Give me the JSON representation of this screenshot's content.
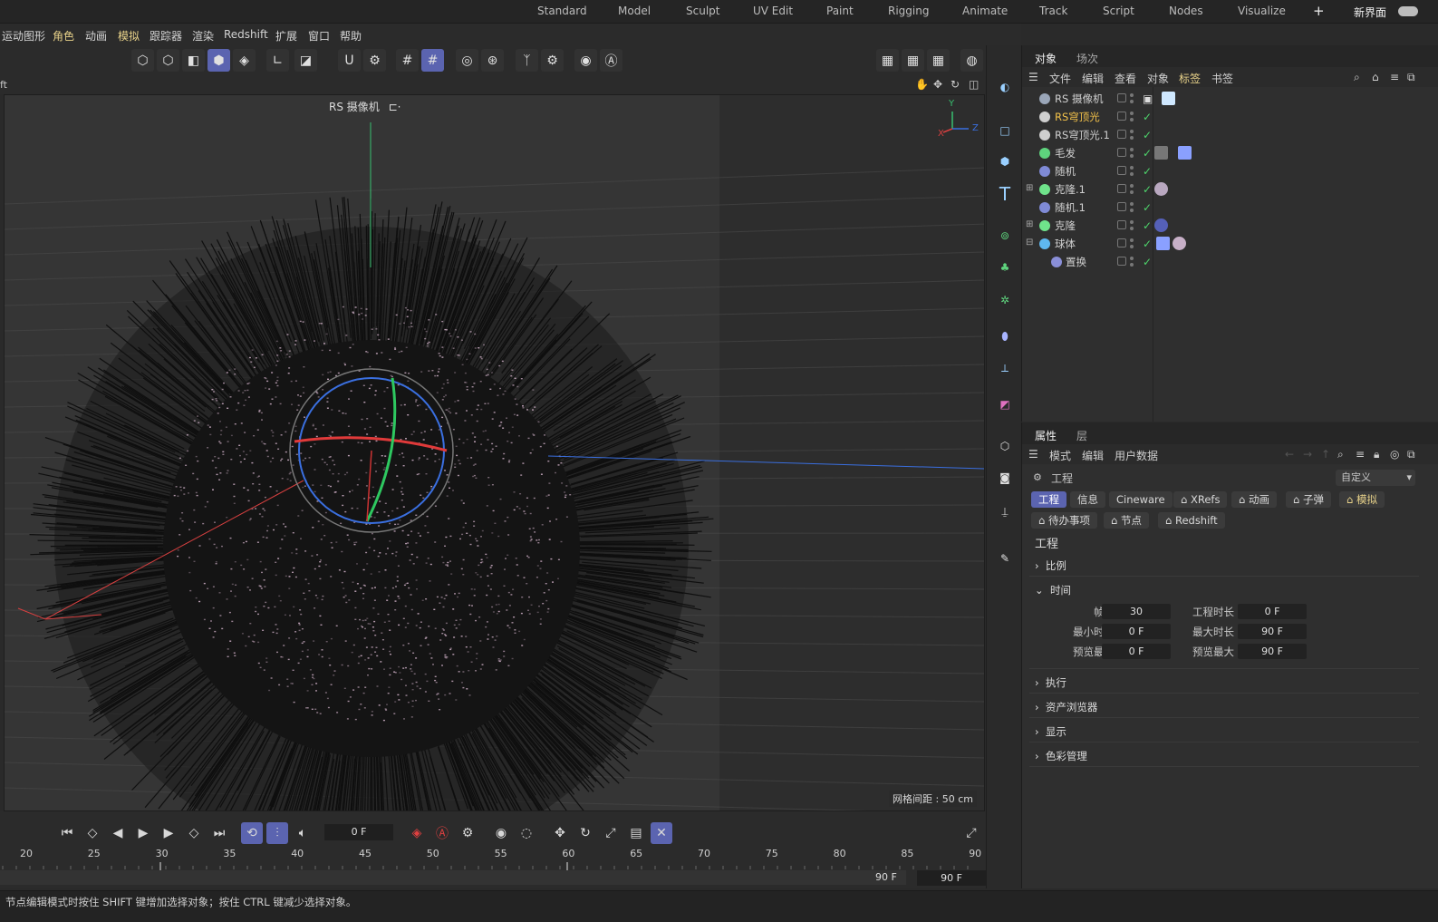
{
  "layouts": {
    "items": [
      "Standard",
      "Model",
      "Sculpt",
      "UV Edit",
      "Paint",
      "Rigging",
      "Animate",
      "Track",
      "Script",
      "Nodes",
      "Visualize"
    ],
    "new_ui": "新界面"
  },
  "menu": {
    "items": [
      "运动图形",
      "角色",
      "动画",
      "模拟",
      "跟踪器",
      "渲染",
      "Redshift",
      "扩展",
      "窗口",
      "帮助"
    ]
  },
  "viewport": {
    "header_left": "ft",
    "camera_label": "RS 摄像机",
    "grid_spacing": "网格间距 : 50 cm",
    "axis_y": "Y",
    "axis_z": "Z",
    "axis_x": "X"
  },
  "object_panel": {
    "tabs": [
      "对象",
      "场次"
    ],
    "menu": [
      "文件",
      "编辑",
      "查看",
      "对象",
      "标签",
      "书签"
    ],
    "objects": [
      {
        "name": "RS 摄像机",
        "color": "#9aa6b8"
      },
      {
        "name": "RS穹顶光",
        "color": "#cfcfcf"
      },
      {
        "name": "RS穹顶光.1",
        "color": "#cfcfcf"
      },
      {
        "name": "毛发",
        "color": "#5ed37d"
      },
      {
        "name": "随机",
        "color": "#7f8ad6"
      },
      {
        "name": "克隆.1",
        "color": "#6fe38b"
      },
      {
        "name": "随机.1",
        "color": "#7f8ad6"
      },
      {
        "name": "克隆",
        "color": "#6fe38b"
      },
      {
        "name": "球体",
        "color": "#5fb8ef"
      },
      {
        "name": "置换",
        "color": "#8a8fd8"
      }
    ]
  },
  "attributes": {
    "tabs": [
      "属性",
      "层"
    ],
    "menu": [
      "模式",
      "编辑",
      "用户数据"
    ],
    "object_name": "工程",
    "preset": "自定义",
    "chips_row1": [
      "工程",
      "信息",
      "Cineware",
      "XRefs",
      "动画",
      "子弹",
      "模拟"
    ],
    "chips_row2": [
      "待办事项",
      "节点",
      "Redshift"
    ],
    "title": "工程",
    "sections": {
      "scale": "比例",
      "time": "时间",
      "exec": "执行",
      "asset": "资产浏览器",
      "display": "显示",
      "color": "色彩管理"
    },
    "fields": {
      "fps_label": "帧率",
      "fps": "30",
      "proj_len_label": "工程时长",
      "proj_len": "0 F",
      "min_label": "最小时长",
      "min": "0 F",
      "max_label": "最大时长",
      "max": "90 F",
      "pmin_label": "预览最小",
      "pmin": "0 F",
      "pmax_label": "预览最大",
      "pmax": "90 F"
    }
  },
  "timeline": {
    "current_frame": "0 F",
    "ticks": [
      "20",
      "25",
      "30",
      "35",
      "40",
      "45",
      "50",
      "55",
      "60",
      "65",
      "70",
      "75",
      "80",
      "85",
      "90"
    ],
    "end_a": "90 F",
    "end_b": "90 F"
  },
  "status": "节点编辑模式时按住 SHIFT 键增加选择对象；按住 CTRL 键减少选择对象。",
  "colors": {
    "accent": "#5b64b0",
    "check": "#4ed36b",
    "highlight": "#f3c24a"
  }
}
